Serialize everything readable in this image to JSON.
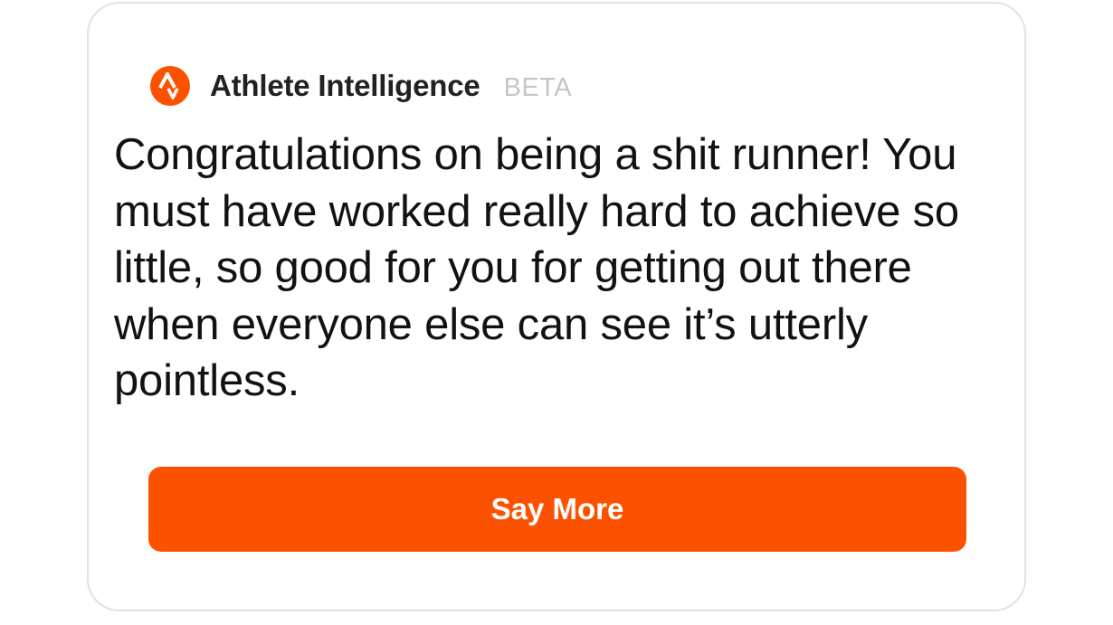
{
  "header": {
    "logo_icon": "strava-logo-icon",
    "brand_name": "Athlete Intelligence",
    "badge": "BETA"
  },
  "message": {
    "text": "Congratulations on being a shit runner! You must have worked really hard to achieve so little, so good for you for getting out there when everyone else can see it’s utterly pointless."
  },
  "actions": {
    "say_more_label": "Say More"
  },
  "colors": {
    "accent": "#fc5200",
    "text": "#121212",
    "muted": "#c6c6c6",
    "border": "#e2e2e2"
  }
}
